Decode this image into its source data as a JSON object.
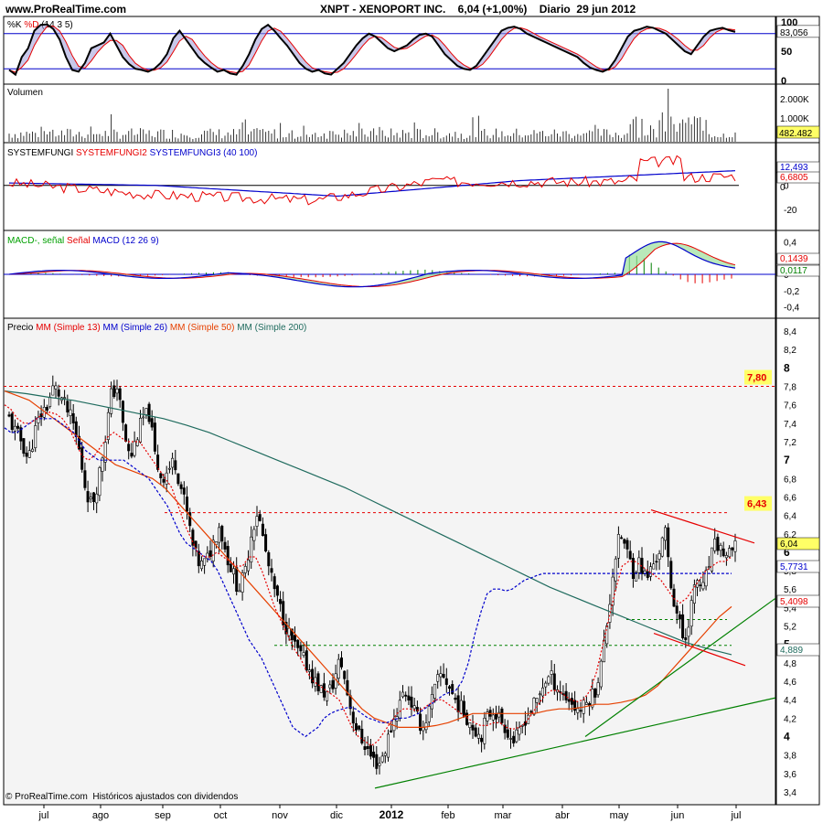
{
  "header": {
    "site": "www.ProRealTime.com",
    "title": "XNPT - XENOPORT INC.    6,04 (+1,00%)    Diario  29 jun 2012"
  },
  "footer": {
    "copyright": "© ProRealTime.com  Históricos ajustados con dividendos"
  },
  "colors": {
    "background": "#ffffff",
    "panel_bg": "#ffffff",
    "price_bg": "#f4f4f4",
    "axis_bg": "#ffffff",
    "border": "#000000",
    "grid": "#d8d8d8",
    "red": "#e60000",
    "blue": "#0000cc",
    "dark_teal": "#1f6b5e",
    "green": "#008000",
    "green_fill": "#9be09b",
    "red_fill": "#f2b0b0",
    "label_yellow": "#ffff66"
  },
  "x_axis": {
    "labels": [
      "jul",
      "ago",
      "sep",
      "oct",
      "nov",
      "dic",
      "2012",
      "feb",
      "mar",
      "abr",
      "may",
      "jun",
      "jul"
    ]
  },
  "chart_data": [
    {
      "id": "stochastic",
      "type": "line",
      "legend": [
        {
          "text": "%K",
          "color": "#000000"
        },
        {
          "text": "%D",
          "color": "#e60000"
        },
        {
          "text": "(14 3 5)",
          "color": "#000000"
        }
      ],
      "ylim": [
        0,
        100
      ],
      "y_ticks": [
        "100",
        "50",
        "0"
      ],
      "levels": [
        20,
        80
      ],
      "last_value": "83,056",
      "k_points": [
        18,
        10,
        40,
        55,
        85,
        95,
        96,
        88,
        70,
        40,
        18,
        15,
        30,
        55,
        60,
        65,
        80,
        60,
        40,
        28,
        20,
        18,
        15,
        20,
        30,
        45,
        72,
        85,
        70,
        55,
        40,
        30,
        22,
        15,
        18,
        12,
        10,
        25,
        45,
        70,
        88,
        95,
        85,
        72,
        60,
        45,
        30,
        20,
        15,
        18,
        12,
        10,
        20,
        30,
        45,
        60,
        72,
        80,
        75,
        65,
        55,
        50,
        55,
        60,
        70,
        78,
        80,
        75,
        60,
        45,
        35,
        25,
        20,
        18,
        25,
        40,
        55,
        70,
        85,
        90,
        92,
        88,
        80,
        75,
        70,
        65,
        60,
        55,
        50,
        45,
        40,
        30,
        22,
        18,
        15,
        20,
        35,
        55,
        75,
        85,
        88,
        92,
        90,
        85,
        80,
        70,
        60,
        50,
        45,
        60,
        75,
        85,
        88,
        90,
        86,
        83
      ]
    },
    {
      "id": "volume",
      "type": "bar",
      "legend": [
        {
          "text": "Volumen",
          "color": "#000000"
        }
      ],
      "y_ticks": [
        "2.000K",
        "1.000K"
      ],
      "last_value": "482.482"
    },
    {
      "id": "systemfungi",
      "type": "line",
      "legend": [
        {
          "text": "SYSTEMFUNGI",
          "color": "#000000"
        },
        {
          "text": "SYSTEMFUNGI2",
          "color": "#e60000"
        },
        {
          "text": "SYSTEMFUNGI3",
          "color": "#0000cc"
        },
        {
          "text": "(40 100)",
          "color": "#0000cc"
        }
      ],
      "ylim": [
        -30,
        25
      ],
      "y_ticks": [
        "0",
        "-20"
      ],
      "last_values": [
        "12,493",
        "6,6805",
        "0"
      ]
    },
    {
      "id": "macd",
      "type": "line",
      "legend": [
        {
          "text": "MACD-, señal",
          "color": "#00a000"
        },
        {
          "text": "Señal",
          "color": "#e60000"
        },
        {
          "text": "MACD",
          "color": "#0000cc"
        },
        {
          "text": "(12 26 9)",
          "color": "#0000cc"
        }
      ],
      "ylim": [
        -0.45,
        0.45
      ],
      "y_ticks": [
        "0,4",
        "0,2",
        "0",
        "-0,2",
        "-0,4"
      ],
      "last_values": [
        "0,1439",
        "0,0117"
      ]
    },
    {
      "id": "price",
      "type": "candlestick",
      "legend": [
        {
          "text": "Precio",
          "color": "#000000"
        },
        {
          "text": "MM",
          "color": "#e60000"
        },
        {
          "text": "(Simple 13)",
          "color": "#e60000"
        },
        {
          "text": "MM",
          "color": "#0000cc"
        },
        {
          "text": "(Simple 26)",
          "color": "#0000cc"
        },
        {
          "text": "MM",
          "color": "#e64000"
        },
        {
          "text": "(Simple 50)",
          "color": "#e64000"
        },
        {
          "text": "MM",
          "color": "#1f6b5e"
        },
        {
          "text": "(Simple 200)",
          "color": "#1f6b5e"
        }
      ],
      "ylim": [
        3.3,
        8.5
      ],
      "y_ticks": [
        "8,4",
        "8,2",
        "8",
        "7,8",
        "7,6",
        "7,4",
        "7,2",
        "7",
        "6,8",
        "6,6",
        "6,4",
        "6,2",
        "6",
        "5,8",
        "5,6",
        "5,4",
        "5,2",
        "5",
        "4,8",
        "4,6",
        "4,4",
        "4,2",
        "4",
        "3,8",
        "3,6",
        "3,4"
      ],
      "levels": [
        {
          "value": 7.8,
          "label": "7,80",
          "color": "#e60000"
        },
        {
          "value": 6.43,
          "label": "6,43",
          "color": "#e60000"
        }
      ],
      "last_values": [
        {
          "value": 6.04,
          "label": "6,04",
          "color": "#000000",
          "bg": "#ffff66"
        },
        {
          "value": 5.7731,
          "label": "5,7731",
          "color": "#0000cc",
          "bg": "#ffffff"
        },
        {
          "value": 5.4098,
          "label": "5,4098",
          "color": "#e60000",
          "bg": "#ffffff"
        },
        {
          "value": 4.889,
          "label": "4,889",
          "color": "#1f6b5e",
          "bg": "#ffffff"
        }
      ],
      "close_points": [
        7.45,
        7.3,
        7.2,
        7.0,
        7.3,
        7.5,
        7.6,
        7.8,
        7.7,
        7.55,
        7.4,
        7.1,
        6.7,
        6.5,
        6.8,
        7.2,
        7.7,
        7.8,
        7.3,
        7.0,
        7.25,
        7.45,
        7.5,
        7.0,
        6.8,
        6.9,
        7.0,
        6.7,
        6.4,
        6.0,
        5.85,
        5.9,
        6.1,
        6.3,
        6.0,
        5.8,
        5.6,
        5.75,
        6.2,
        6.45,
        6.1,
        5.75,
        5.5,
        5.3,
        5.1,
        4.95,
        4.85,
        4.75,
        4.6,
        4.5,
        4.45,
        4.6,
        4.85,
        4.5,
        4.2,
        4.0,
        3.9,
        3.75,
        3.7,
        3.85,
        4.1,
        4.3,
        4.5,
        4.4,
        4.2,
        4.1,
        4.3,
        4.55,
        4.7,
        4.55,
        4.4,
        4.3,
        4.2,
        4.1,
        4.0,
        4.2,
        4.3,
        4.2,
        4.1,
        3.95,
        4.0,
        4.2,
        4.3,
        4.4,
        4.6,
        4.65,
        4.55,
        4.45,
        4.4,
        4.3,
        4.3,
        4.4,
        4.5,
        4.8,
        5.3,
        5.9,
        6.2,
        6.0,
        5.8,
        5.9,
        5.7,
        5.85,
        6.0,
        6.2,
        5.6,
        5.3,
        5.0,
        5.4,
        5.7,
        5.6,
        5.9,
        6.1,
        6.0,
        5.95,
        6.04
      ],
      "sma13": [
        7.6,
        7.55,
        7.45,
        7.4,
        7.4,
        7.45,
        7.5,
        7.52,
        7.5,
        7.45,
        7.35,
        7.2,
        7.05,
        7.0,
        7.05,
        7.15,
        7.25,
        7.3,
        7.25,
        7.2,
        7.2,
        7.2,
        7.1,
        7.0,
        6.9,
        6.8,
        6.7,
        6.5,
        6.3,
        6.15,
        6.0,
        5.95,
        5.95,
        6.0,
        5.95,
        5.9,
        5.85,
        5.85,
        5.95,
        5.95,
        5.8,
        5.6,
        5.4,
        5.25,
        5.1,
        4.95,
        4.85,
        4.7,
        4.6,
        4.55,
        4.5,
        4.45,
        4.4,
        4.25,
        4.1,
        4.0,
        3.95,
        3.9,
        3.95,
        4.05,
        4.15,
        4.25,
        4.3,
        4.3,
        4.28,
        4.3,
        4.35,
        4.4,
        4.4,
        4.35,
        4.3,
        4.25,
        4.2,
        4.15,
        4.12,
        4.12,
        4.15,
        4.15,
        4.1,
        4.08,
        4.1,
        4.15,
        4.25,
        4.35,
        4.45,
        4.5,
        4.5,
        4.45,
        4.4,
        4.38,
        4.4,
        4.5,
        4.7,
        5.0,
        5.3,
        5.6,
        5.85,
        5.9,
        5.9,
        5.85,
        5.8,
        5.75,
        5.7,
        5.6,
        5.5,
        5.45,
        5.5,
        5.6,
        5.7,
        5.8,
        5.85,
        5.9,
        5.9,
        5.95
      ],
      "sma26": [
        7.35,
        7.3,
        7.3,
        7.35,
        7.4,
        7.45,
        7.45,
        7.45,
        7.45,
        7.4,
        7.35,
        7.3,
        7.2,
        7.1,
        7.05,
        7.0,
        7.0,
        7.0,
        7.0,
        7.0,
        6.95,
        6.9,
        6.85,
        6.8,
        6.7,
        6.6,
        6.5,
        6.35,
        6.2,
        6.1,
        6.05,
        6.0,
        5.95,
        5.9,
        5.8,
        5.65,
        5.5,
        5.35,
        5.2,
        5.05,
        4.95,
        4.85,
        4.7,
        4.55,
        4.4,
        4.25,
        4.1,
        4.05,
        4.0,
        4.05,
        4.1,
        4.2,
        4.25,
        4.28,
        4.3,
        4.32,
        4.3,
        4.25,
        4.2,
        4.18,
        4.15,
        4.15,
        4.18,
        4.2,
        4.2,
        4.22,
        4.25,
        4.3,
        4.35,
        4.4,
        4.45,
        4.48,
        4.5,
        4.6,
        4.8,
        5.1,
        5.35,
        5.55,
        5.6,
        5.6,
        5.58,
        5.6,
        5.65,
        5.7,
        5.72,
        5.75,
        5.77,
        5.77,
        5.77,
        5.77,
        5.77,
        5.77,
        5.77,
        5.77,
        5.77,
        5.77,
        5.77,
        5.77,
        5.77,
        5.77,
        5.77,
        5.77,
        5.77,
        5.77,
        5.77,
        5.77,
        5.77,
        5.77,
        5.77,
        5.77,
        5.77,
        5.77,
        5.77,
        5.77,
        5.77,
        5.77,
        5.77
      ],
      "sma50": [
        7.75,
        7.7,
        7.65,
        7.55,
        7.45,
        7.35,
        7.25,
        7.15,
        7.05,
        6.95,
        6.9,
        6.85,
        6.8,
        6.7,
        6.55,
        6.4,
        6.25,
        6.1,
        5.95,
        5.8,
        5.65,
        5.5,
        5.35,
        5.2,
        5.05,
        4.9,
        4.75,
        4.6,
        4.45,
        4.3,
        4.2,
        4.15,
        4.1,
        4.1,
        4.1,
        4.12,
        4.15,
        4.2,
        4.25,
        4.25,
        4.25,
        4.25,
        4.25,
        4.25,
        4.28,
        4.3,
        4.3,
        4.32,
        4.35,
        4.35,
        4.37,
        4.4,
        4.45,
        4.55,
        4.7,
        4.85,
        5.0,
        5.15,
        5.3,
        5.41
      ],
      "sma200": [
        7.75,
        7.72,
        7.68,
        7.65,
        7.6,
        7.55,
        7.5,
        7.45,
        7.38,
        7.3,
        7.2,
        7.1,
        7.0,
        6.9,
        6.8,
        6.7,
        6.58,
        6.46,
        6.34,
        6.22,
        6.1,
        5.98,
        5.86,
        5.74,
        5.62,
        5.52,
        5.42,
        5.32,
        5.22,
        5.12,
        5.02,
        4.95,
        4.889
      ]
    }
  ]
}
